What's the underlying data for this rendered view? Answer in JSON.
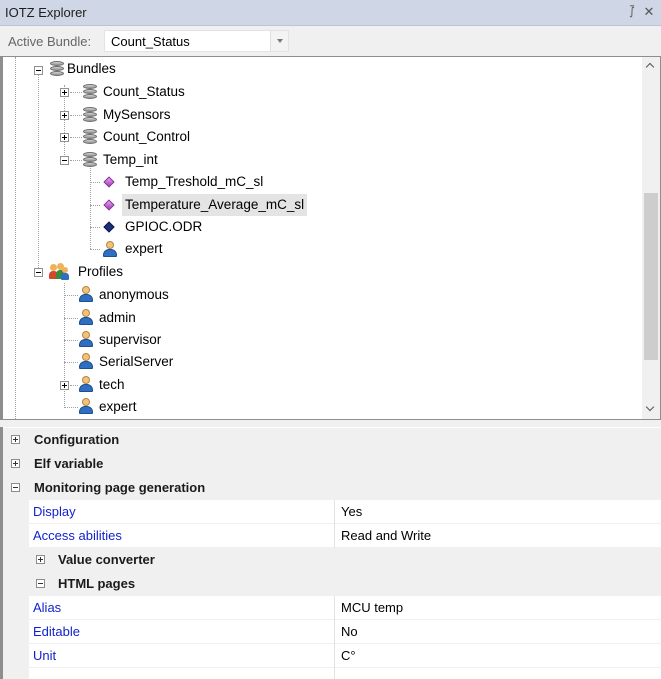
{
  "window": {
    "title": "IOTZ Explorer",
    "pin_glyph": "⨛",
    "close_glyph": "✕"
  },
  "bundle_selector": {
    "label": "Active Bundle:",
    "value": "Count_Status"
  },
  "tree": {
    "root": {
      "label": "Bundles",
      "icon": "database-stack-icon",
      "expanded": true
    },
    "bundles": [
      {
        "label": "Count_Status",
        "icon": "database-icon",
        "expanded": false
      },
      {
        "label": "MySensors",
        "icon": "database-icon",
        "expanded": false
      },
      {
        "label": "Count_Control",
        "icon": "database-icon",
        "expanded": false
      },
      {
        "label": "Temp_int",
        "icon": "database-icon",
        "expanded": true
      }
    ],
    "temp_int_children": [
      {
        "label": "Temp_Treshold_mC_sl",
        "icon": "purple-diamond-icon"
      },
      {
        "label": "Temperature_Average_mC_sl",
        "icon": "purple-diamond-icon",
        "selected": true
      },
      {
        "label": "GPIOC.ODR",
        "icon": "navy-diamond-icon"
      },
      {
        "label": "expert",
        "icon": "user-icon"
      }
    ],
    "profiles": {
      "label": "Profiles",
      "icon": "profiles-icon",
      "expanded": true
    },
    "profile_children": [
      {
        "label": "anonymous",
        "icon": "user-icon"
      },
      {
        "label": "admin",
        "icon": "user-icon"
      },
      {
        "label": "supervisor",
        "icon": "user-icon"
      },
      {
        "label": "SerialServer",
        "icon": "user-icon"
      },
      {
        "label": "tech",
        "icon": "user-icon",
        "expandable": true
      },
      {
        "label": "expert",
        "icon": "user-icon"
      }
    ]
  },
  "properties": {
    "categories": {
      "configuration": "Configuration",
      "elf_variable": "Elf variable",
      "monitoring": "Monitoring page generation",
      "value_converter": "Value converter",
      "html_pages": "HTML pages"
    },
    "monitoring_rows": [
      {
        "key": "Display",
        "value": "Yes"
      },
      {
        "key": "Access abilities",
        "value": "Read and Write"
      }
    ],
    "html_rows": [
      {
        "key": "Alias",
        "value": "MCU temp"
      },
      {
        "key": "Editable",
        "value": "No"
      },
      {
        "key": "Unit",
        "value": "C°"
      }
    ]
  },
  "colors": {
    "title_bar": "#cfd6e5",
    "property_key": "#0f1fcf",
    "selection": "#e4e4e4"
  }
}
